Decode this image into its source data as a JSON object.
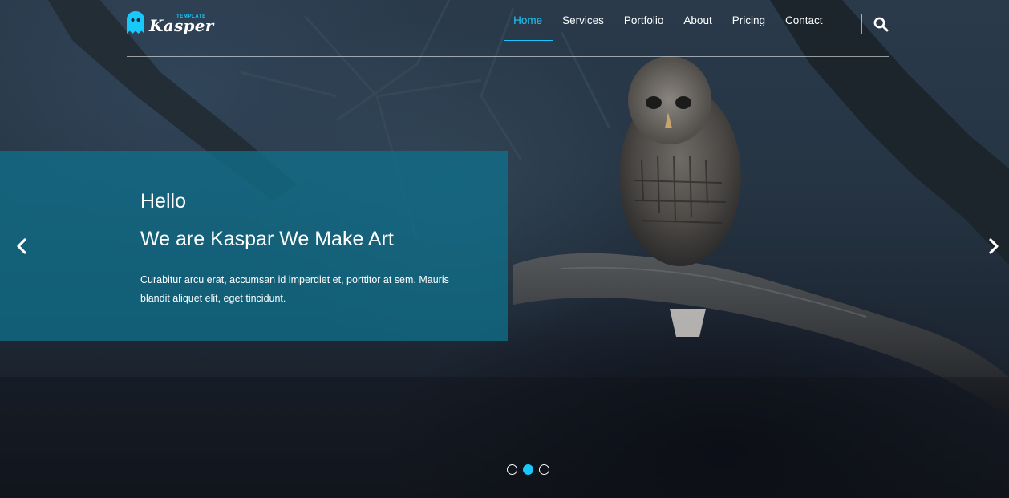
{
  "brand": {
    "name": "Kasper",
    "tagline": "TEMPLATE",
    "accent_color": "#19c8fa",
    "logo_icon": "ghost-icon"
  },
  "nav": {
    "items": [
      {
        "label": "Home",
        "active": true
      },
      {
        "label": "Services",
        "active": false
      },
      {
        "label": "Portfolio",
        "active": false
      },
      {
        "label": "About",
        "active": false
      },
      {
        "label": "Pricing",
        "active": false
      },
      {
        "label": "Contact",
        "active": false
      }
    ],
    "search_icon": "search-icon"
  },
  "slider": {
    "caption": {
      "greeting": "Hello",
      "title": "We are Kaspar We Make Art",
      "text": "Curabitur arcu erat, accumsan id imperdiet et, porttitor at sem. Mauris blandit aliquet elit, eget tincidunt."
    },
    "caption_color": "#106e8b",
    "prev_icon": "chevron-left-icon",
    "next_icon": "chevron-right-icon",
    "slide_count": 3,
    "active_slide": 2
  }
}
